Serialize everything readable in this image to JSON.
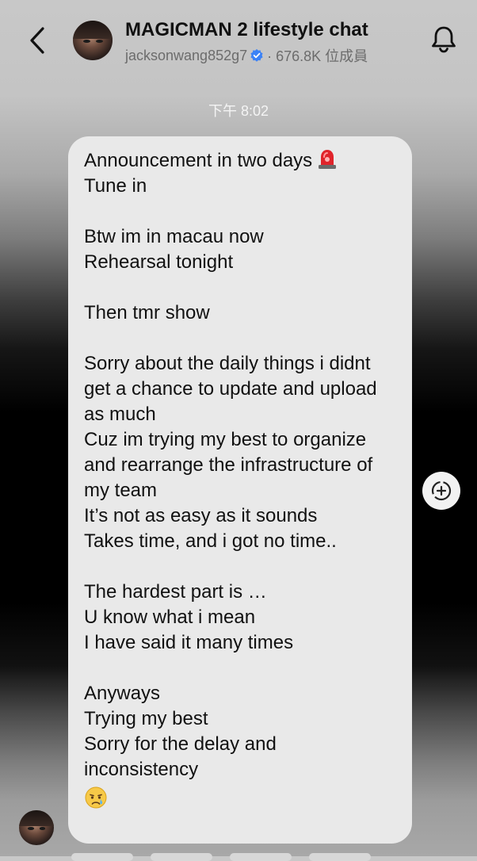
{
  "header": {
    "back_icon": "chevron-left-icon",
    "title": "MAGICMAN 2 lifestyle chat",
    "username": "jacksonwang852g7",
    "verified_icon": "verified-badge-icon",
    "member_count": "· 676.8K 位成員",
    "bell_icon": "bell-icon"
  },
  "timestamp": "下午 8:02",
  "message": {
    "lines": [
      "Announcement in two days",
      "Tune in",
      "",
      "Btw im in macau now",
      "Rehearsal tonight",
      "",
      "Then tmr show",
      "",
      "Sorry about the daily things i didnt",
      "get a chance to update and upload",
      "as much",
      "Cuz im trying my best to organize",
      "and rearrange the infrastructure of",
      "my team",
      "It’s not as easy as it sounds",
      "Takes time, and i got no time..",
      "",
      "The hardest part is …",
      "U know what i mean",
      "I have said it many times",
      "",
      "Anyways",
      "Trying my best",
      "Sorry for the delay and",
      "inconsistency"
    ],
    "emoji_1": "rotating-light-emoji",
    "emoji_2": "crying-face-emoji"
  },
  "side_action_icon": "add-reaction-icon",
  "colors": {
    "bubble": "#e9e9e9",
    "verified": "#3b82f6",
    "text": "#111111",
    "subtext": "#6c6c6c"
  }
}
